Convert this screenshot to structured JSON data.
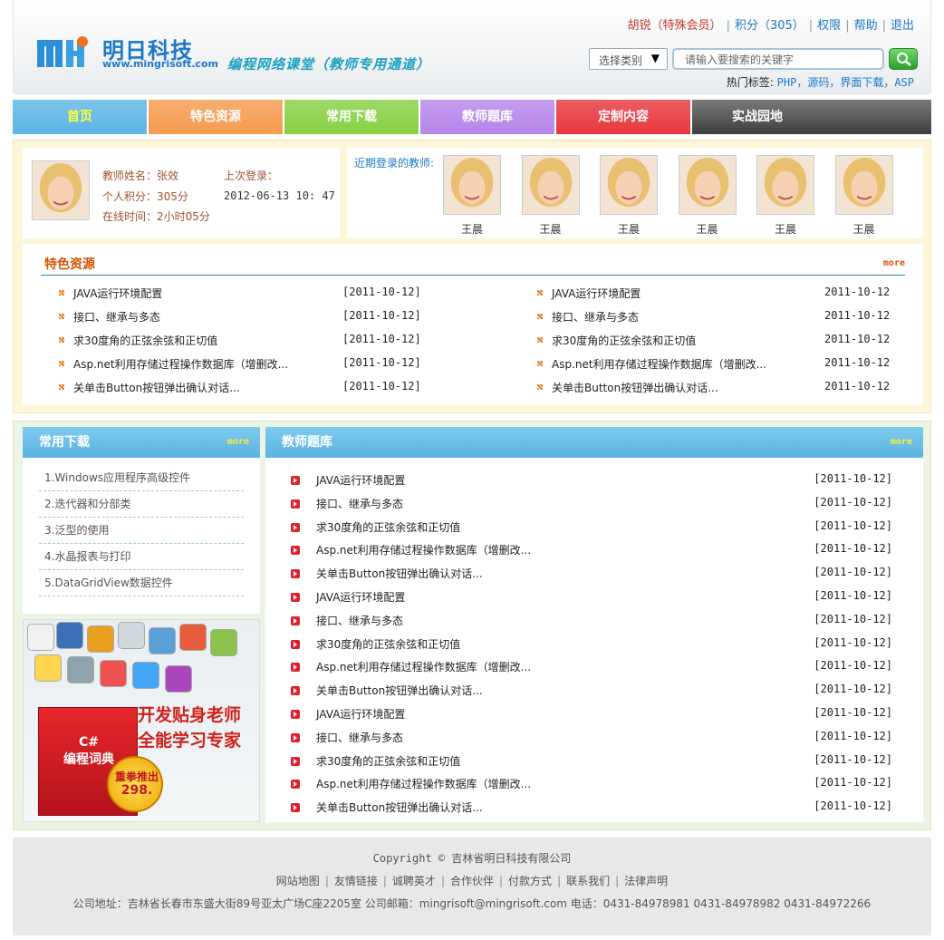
{
  "header": {
    "logo_cn": "明日科技",
    "logo_url": "www.mingrisoft.com",
    "slogan": "编程网络课堂（教师专用通道）",
    "user": "胡锐（特殊会员）",
    "points": "积分（305）",
    "permissions": "权限",
    "help": "帮助",
    "logout": "退出",
    "category_label": "选择类别",
    "search_placeholder": "请输入要搜索的关键字",
    "hot_tags_label": "热门标签:",
    "hot_tags": "PHP，源码，界面下载，ASP"
  },
  "nav": [
    {
      "label": "首页",
      "color": "#5bb5e6",
      "text_color": "#ffff33"
    },
    {
      "label": "特色资源",
      "color": "#f59a4d"
    },
    {
      "label": "常用下载",
      "color": "#86d042"
    },
    {
      "label": "教师题库",
      "color": "#b585e9"
    },
    {
      "label": "定制内容",
      "color": "#e7363c"
    },
    {
      "label": "实战园地",
      "color": "#555555"
    }
  ],
  "profile": {
    "name_label": "教师姓名：张效",
    "points_label": "个人积分：305分",
    "online_label": "在线时间：2小时05分",
    "last_login_label": "上次登录：",
    "last_login_value": "2012-06-13 10: 47"
  },
  "recent": {
    "label": "近期登录的教师:",
    "teachers": [
      "王晨",
      "王晨",
      "王晨",
      "王晨",
      "王晨",
      "王晨"
    ]
  },
  "featured": {
    "title": "特色资源",
    "more": "more",
    "left": [
      {
        "title": "JAVA运行环境配置",
        "date": "[2011-10-12]"
      },
      {
        "title": "接口、继承与多态",
        "date": "[2011-10-12]"
      },
      {
        "title": "求30度角的正弦余弦和正切值",
        "date": "[2011-10-12]"
      },
      {
        "title": "Asp.net利用存储过程操作数据库（增删改...",
        "date": "[2011-10-12]"
      },
      {
        "title": "关单击Button按钮弹出确认对话...",
        "date": "[2011-10-12]"
      }
    ],
    "right": [
      {
        "title": "JAVA运行环境配置",
        "date": "2011-10-12"
      },
      {
        "title": "接口、继承与多态",
        "date": "2011-10-12"
      },
      {
        "title": "求30度角的正弦余弦和正切值",
        "date": "2011-10-12"
      },
      {
        "title": "Asp.net利用存储过程操作数据库（增删改...",
        "date": "2011-10-12"
      },
      {
        "title": "关单击Button按钮弹出确认对话...",
        "date": "2011-10-12"
      }
    ]
  },
  "downloads": {
    "title": "常用下载",
    "more": "more",
    "items": [
      "1.Windows应用程序高级控件",
      "2.迭代器和分部类",
      "3.泛型的使用",
      "4.水晶报表与打印",
      "5.DataGridView数据控件"
    ]
  },
  "ad": {
    "line1": "开发贴身老师",
    "line2": "全能学习专家",
    "book_title": "C#\n编程词典",
    "badge": "重拳推出",
    "price": "298."
  },
  "exam": {
    "title": "教师题库",
    "more": "more",
    "items": [
      {
        "title": "JAVA运行环境配置",
        "date": "[2011-10-12]"
      },
      {
        "title": "接口、继承与多态",
        "date": "[2011-10-12]"
      },
      {
        "title": "求30度角的正弦余弦和正切值",
        "date": "[2011-10-12]"
      },
      {
        "title": "Asp.net利用存储过程操作数据库（增删改...",
        "date": "[2011-10-12]"
      },
      {
        "title": "关单击Button按钮弹出确认对话...",
        "date": "[2011-10-12]"
      },
      {
        "title": "JAVA运行环境配置",
        "date": "[2011-10-12]"
      },
      {
        "title": "接口、继承与多态",
        "date": "[2011-10-12]"
      },
      {
        "title": "求30度角的正弦余弦和正切值",
        "date": "[2011-10-12]"
      },
      {
        "title": "Asp.net利用存储过程操作数据库（增删改...",
        "date": "[2011-10-12]"
      },
      {
        "title": "关单击Button按钮弹出确认对话...",
        "date": "[2011-10-12]"
      },
      {
        "title": "JAVA运行环境配置",
        "date": "[2011-10-12]"
      },
      {
        "title": "接口、继承与多态",
        "date": "[2011-10-12]"
      },
      {
        "title": "求30度角的正弦余弦和正切值",
        "date": "[2011-10-12]"
      },
      {
        "title": "Asp.net利用存储过程操作数据库（增删改...",
        "date": "[2011-10-12]"
      },
      {
        "title": "关单击Button按钮弹出确认对话...",
        "date": "[2011-10-12]"
      }
    ]
  },
  "footer": {
    "copyright": "Copyright © 吉林省明日科技有限公司",
    "links": [
      "网站地图",
      "友情链接",
      "诚聘英才",
      "合作伙伴",
      "付款方式",
      "联系我们",
      "法律声明"
    ],
    "address": "公司地址：吉林省长春市东盛大街89号亚太广场C座2205室  公司邮箱：mingrisoft@mingrisoft.com  电话：0431-84978981  0431-84978982  0431-84972266"
  }
}
